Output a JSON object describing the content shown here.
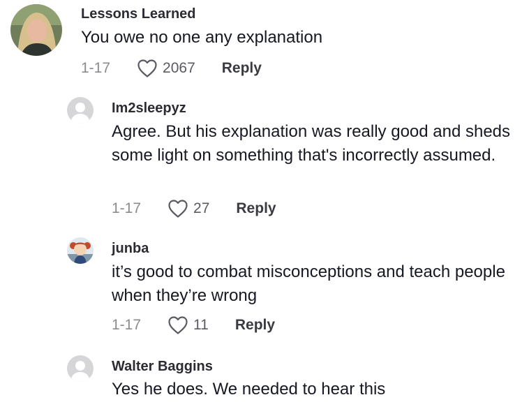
{
  "comments": [
    {
      "username": "Lessons Learned",
      "text": "You owe no one any explanation",
      "date": "1-17",
      "likes": "2067",
      "reply_label": "Reply"
    },
    {
      "username": "Im2sleepyz",
      "text": "Agree. But his explanation was really good and sheds some light on something that's incorrectly assumed.",
      "date": "1-17",
      "likes": "27",
      "reply_label": "Reply"
    },
    {
      "username": "junba",
      "text": "it’s good to combat misconceptions and teach people when they’re wrong",
      "date": "1-17",
      "likes": "11",
      "reply_label": "Reply"
    },
    {
      "username": "Walter Baggins",
      "text": "Yes he does. We needed to hear this"
    }
  ],
  "icons": {
    "like": "heart-outline-icon",
    "default_avatar": "person-silhouette-icon"
  },
  "colors": {
    "text": "#161823",
    "meta": "#8a8b91",
    "reply": "#3a3b42"
  }
}
